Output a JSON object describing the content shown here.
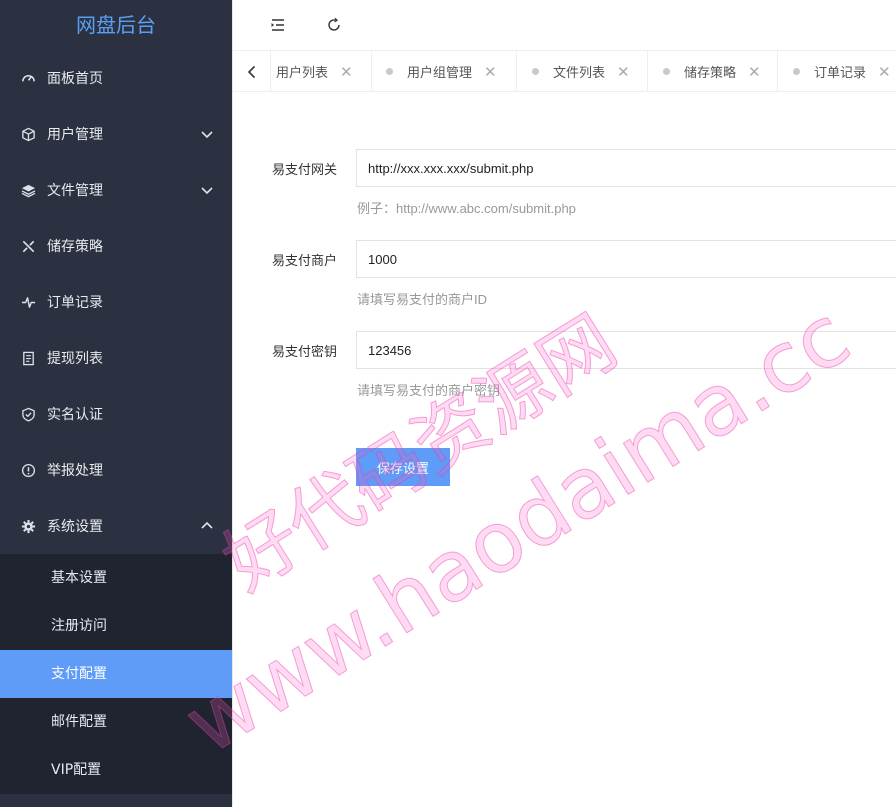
{
  "app_title": "网盘后台",
  "sidebar": {
    "items": [
      {
        "label": "面板首页",
        "icon": "dashboard-icon"
      },
      {
        "label": "用户管理",
        "icon": "cube-icon",
        "expand": "down"
      },
      {
        "label": "文件管理",
        "icon": "layers-icon",
        "expand": "down"
      },
      {
        "label": "储存策略",
        "icon": "tools-icon"
      },
      {
        "label": "订单记录",
        "icon": "pulse-icon"
      },
      {
        "label": "提现列表",
        "icon": "receipt-icon"
      },
      {
        "label": "实名认证",
        "icon": "shield-check-icon"
      },
      {
        "label": "举报处理",
        "icon": "alert-circle-icon"
      },
      {
        "label": "系统设置",
        "icon": "gear-icon",
        "expand": "up"
      }
    ],
    "submenu": [
      {
        "label": "基本设置"
      },
      {
        "label": "注册访问"
      },
      {
        "label": "支付配置",
        "active": true
      },
      {
        "label": "邮件配置"
      },
      {
        "label": "VIP配置"
      }
    ]
  },
  "header": {
    "menu_toggle_icon": "indent-icon",
    "refresh_icon": "refresh-icon"
  },
  "tabs": [
    {
      "label": "用户列表"
    },
    {
      "label": "用户组管理"
    },
    {
      "label": "文件列表"
    },
    {
      "label": "储存策略"
    },
    {
      "label": "订单记录"
    }
  ],
  "form": {
    "gateway": {
      "label": "易支付网关",
      "value": "http://xxx.xxx.xxx/submit.php",
      "hint": "例子：http://www.abc.com/submit.php"
    },
    "merchant": {
      "label": "易支付商户",
      "value": "1000",
      "hint": "请填写易支付的商户ID"
    },
    "key": {
      "label": "易支付密钥",
      "value": "123456",
      "hint": "请填写易支付的商户密钥"
    },
    "save_label": "保存设置"
  },
  "watermark": {
    "line1": "好代码资源网",
    "line2": "www.haodaima.cc"
  },
  "colors": {
    "sidebar_bg": "#2b3140",
    "submenu_bg": "#1f2430",
    "accent": "#5e9cf7",
    "logo": "#5aa0f2"
  }
}
